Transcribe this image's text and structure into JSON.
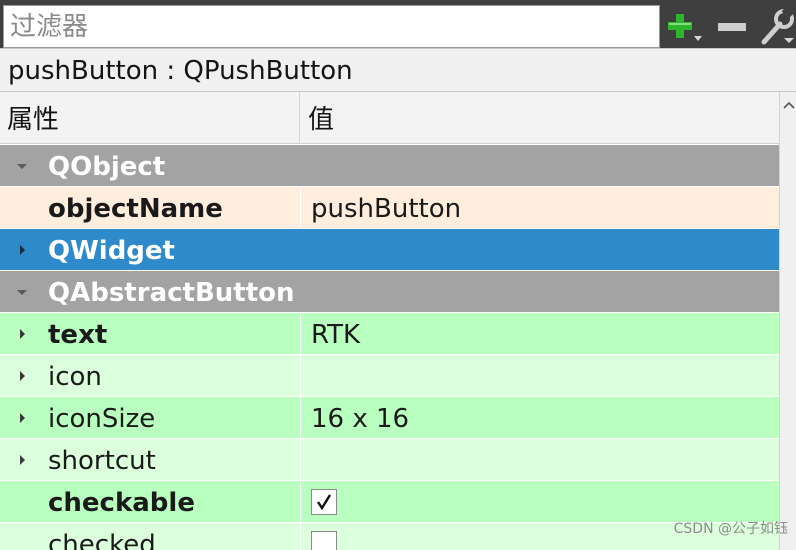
{
  "filter": {
    "placeholder": "过滤器",
    "value": ""
  },
  "toolbar": {
    "add_icon": "plus-dropdown-icon",
    "remove_icon": "minus-icon",
    "config_icon": "wrench-dropdown-icon",
    "add_color": "#2db52d"
  },
  "object_label": "pushButton : QPushButton",
  "table": {
    "headers": {
      "property": "属性",
      "value": "值"
    },
    "rows": [
      {
        "kind": "group",
        "name": "QObject",
        "expanded": true,
        "selected": false
      },
      {
        "kind": "prop",
        "name": "objectName",
        "value": "pushButton",
        "bold": true,
        "expandable": false,
        "style": "orange"
      },
      {
        "kind": "group",
        "name": "QWidget",
        "expanded": false,
        "selected": true
      },
      {
        "kind": "group",
        "name": "QAbstractButton",
        "expanded": true,
        "selected": false
      },
      {
        "kind": "prop",
        "name": "text",
        "value": "RTK",
        "bold": true,
        "expandable": true,
        "style": "green-a"
      },
      {
        "kind": "prop",
        "name": "icon",
        "value": "",
        "bold": false,
        "expandable": true,
        "style": "green-b"
      },
      {
        "kind": "prop",
        "name": "iconSize",
        "value": "16 x 16",
        "bold": false,
        "expandable": true,
        "style": "green-a"
      },
      {
        "kind": "prop",
        "name": "shortcut",
        "value": "",
        "bold": false,
        "expandable": true,
        "style": "green-b"
      },
      {
        "kind": "prop",
        "name": "checkable",
        "checkbox": true,
        "checked": true,
        "bold": true,
        "expandable": false,
        "style": "green-a"
      },
      {
        "kind": "prop",
        "name": "checked",
        "checkbox": true,
        "checked": false,
        "bold": false,
        "expandable": false,
        "style": "green-b"
      }
    ]
  },
  "colors": {
    "group_gray": "#a3a3a3",
    "group_selected": "#2f8acb",
    "row_orange": "#ffeedd",
    "row_green_a": "#b9ffbf",
    "row_green_b": "#dcffdc"
  },
  "watermark": "CSDN @公子如钰"
}
